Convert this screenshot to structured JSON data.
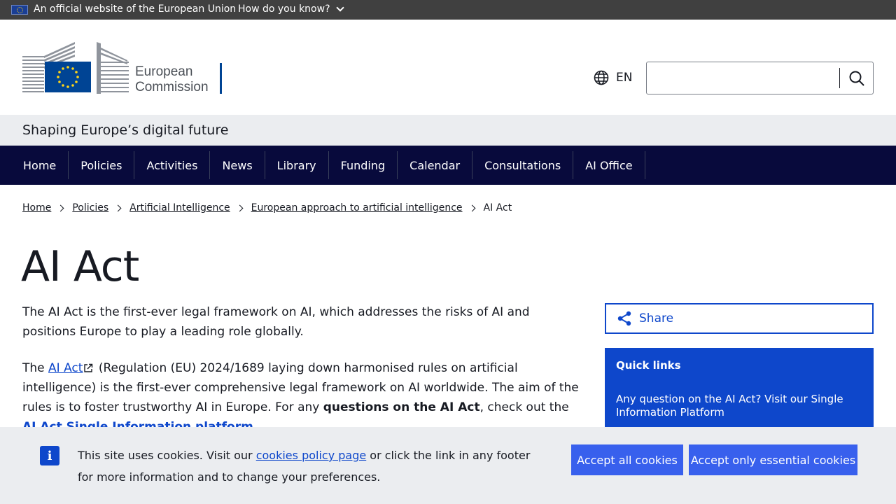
{
  "eu_banner": {
    "official_text": "An official website of the European Union",
    "how_know": "How do you know?"
  },
  "header": {
    "logo_line1": "European",
    "logo_line2": "Commission",
    "language": "EN",
    "search_placeholder": ""
  },
  "site_name": "Shaping Europe’s digital future",
  "menu": {
    "items": [
      {
        "label": "Home"
      },
      {
        "label": "Policies"
      },
      {
        "label": "Activities"
      },
      {
        "label": "News"
      },
      {
        "label": "Library"
      },
      {
        "label": "Funding"
      },
      {
        "label": "Calendar"
      },
      {
        "label": "Consultations"
      },
      {
        "label": "AI Office"
      }
    ]
  },
  "breadcrumb": {
    "items": [
      "Home",
      "Policies",
      "Artificial Intelligence",
      "European approach to artificial intelligence"
    ],
    "current": "AI Act"
  },
  "page": {
    "title": "AI Act",
    "intro": "The AI Act is the first-ever legal framework on AI, which addresses the risks of AI and positions Europe to play a leading role globally.",
    "p2_start": "The ",
    "p2_link": "AI Act",
    "p2_mid": " (Regulation (EU) 2024/1689 laying down harmonised rules on artificial intelligence) is the first-ever comprehensive legal framework on AI worldwide. The aim of the rules is to foster trustworthy AI in Europe. For any ",
    "p2_bold": "questions on the AI Act",
    "p2_after": ", check out the ",
    "p2_link2": "AI Act Single Information platform",
    "p2_end": "."
  },
  "sidebar": {
    "share_label": "Share",
    "quick_links_title": "Quick links",
    "quick_link_1": "Any question on the AI Act? Visit our Single Information Platform"
  },
  "cookie": {
    "text_start": "This site uses cookies. Visit our ",
    "policy_link": "cookies policy page",
    "text_end": " or click the link in any footer for more information and to change your preferences.",
    "accept_all": "Accept all cookies",
    "accept_essential": "Accept only essential cookies"
  },
  "colors": {
    "primary": "#0e47cb",
    "menu_bg": "#080a3c",
    "eu_bar": "#404040"
  }
}
